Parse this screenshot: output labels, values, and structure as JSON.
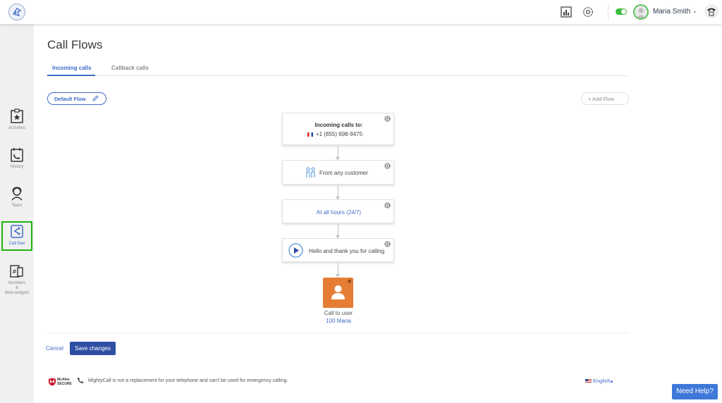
{
  "header": {
    "user_name": "Maria Smith",
    "caret": "⌄",
    "icons": [
      "logo-icon",
      "reports-icon",
      "settings-icon",
      "status-toggle",
      "avatar",
      "phone-icon"
    ]
  },
  "sidebar": {
    "items": [
      {
        "label": "Activities",
        "icon": "activities-icon"
      },
      {
        "label": "History",
        "icon": "history-icon"
      },
      {
        "label": "Team",
        "icon": "team-icon"
      },
      {
        "label": "Call flow",
        "icon": "call-flow-icon",
        "active": true
      },
      {
        "label": "Numbers & Web-widgets",
        "icon": "numbers-icon"
      }
    ],
    "numbers_l1": "Numbers",
    "numbers_l2": "&",
    "numbers_l3": "Web-widgets"
  },
  "main": {
    "title": "Call Flows",
    "tabs": [
      {
        "label": "Incoming calls",
        "active": true
      },
      {
        "label": "Callback calls",
        "active": false
      }
    ],
    "flow_name": "Default Flow",
    "add_flow": "+ Add Flow"
  },
  "flow": {
    "incoming_title": "Incoming calls to:",
    "incoming_number": "+1 (855) 698-9475",
    "customer": "From any customer",
    "hours": "At all hours (24/7)",
    "greeting": "Hello and thank you for calling",
    "call_to": "Call to user",
    "call_user": "100 Maria"
  },
  "actions": {
    "cancel": "Cancel",
    "save": "Save changes"
  },
  "footer": {
    "mcafee_l1": "McAfee",
    "mcafee_l2": "SECURE",
    "disclaimer": "MightyCall is not a replacement for your telephone and can't be used for emergency calling.",
    "language": "English▴",
    "need_help": "Need Help?"
  },
  "colors": {
    "accent": "#3f6bc9",
    "primary_button": "#2e4fa3",
    "user_tile": "#e67d35",
    "active_nav_border": "#1fb30f",
    "online_toggle": "#3cba3c"
  }
}
